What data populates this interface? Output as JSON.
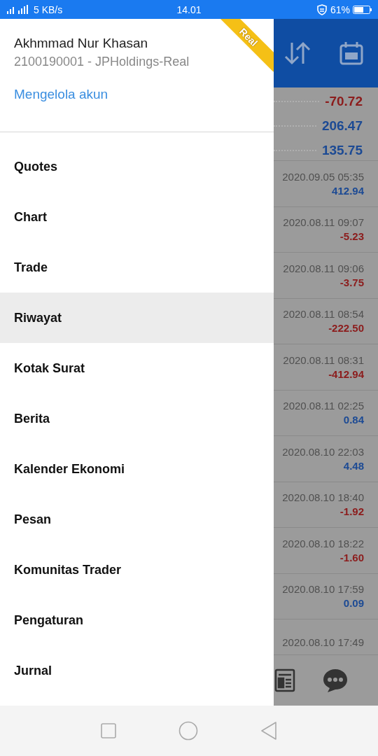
{
  "status_bar": {
    "network": "5 KB/s",
    "time": "14.01",
    "battery": "61%"
  },
  "drawer": {
    "account_name": "Akhmmad Nur Khasan",
    "account_id": "2100190001 - JPHoldings-Real",
    "manage_link": "Mengelola akun",
    "badge": "Real",
    "menu": [
      {
        "label": "Quotes",
        "selected": false
      },
      {
        "label": "Chart",
        "selected": false
      },
      {
        "label": "Trade",
        "selected": false
      },
      {
        "label": "Riwayat",
        "selected": true
      },
      {
        "label": "Kotak Surat",
        "selected": false
      },
      {
        "label": "Berita",
        "selected": false
      },
      {
        "label": "Kalender Ekonomi",
        "selected": false
      },
      {
        "label": "Pesan",
        "selected": false
      },
      {
        "label": "Komunitas Trader",
        "selected": false
      },
      {
        "label": "Pengaturan",
        "selected": false
      },
      {
        "label": "Jurnal",
        "selected": false
      }
    ]
  },
  "background_screen": {
    "summary": [
      {
        "value": "-70.72",
        "kind": "loss"
      },
      {
        "value": "206.47",
        "kind": "profit"
      },
      {
        "value": "135.75",
        "kind": "profit"
      }
    ],
    "history": [
      {
        "time": "2020.09.05 05:35",
        "value": "412.94",
        "kind": "profit"
      },
      {
        "time": "2020.08.11 09:07",
        "value": "-5.23",
        "kind": "loss"
      },
      {
        "time": "2020.08.11 09:06",
        "value": "-3.75",
        "kind": "loss"
      },
      {
        "time": "2020.08.11 08:54",
        "value": "-222.50",
        "kind": "loss"
      },
      {
        "time": "2020.08.11 08:31",
        "value": "-412.94",
        "kind": "loss"
      },
      {
        "time": "2020.08.11 02:25",
        "value": "0.84",
        "kind": "profit"
      },
      {
        "time": "2020.08.10 22:03",
        "value": "4.48",
        "kind": "profit"
      },
      {
        "time": "2020.08.10 18:40",
        "value": "-1.92",
        "kind": "loss"
      },
      {
        "time": "2020.08.10 18:22",
        "value": "-1.60",
        "kind": "loss"
      },
      {
        "time": "2020.08.10 17:59",
        "value": "0.09",
        "kind": "profit"
      },
      {
        "time": "2020.08.10 17:49"
      }
    ]
  }
}
